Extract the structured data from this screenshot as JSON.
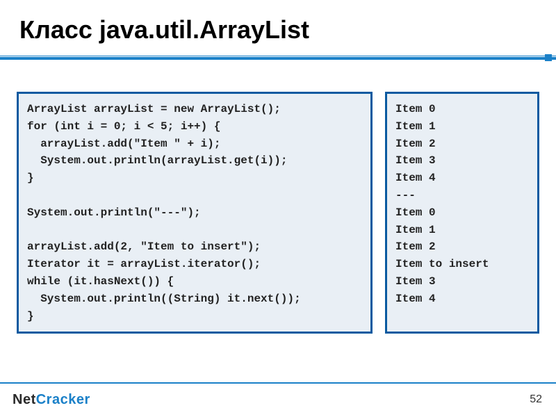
{
  "title": "Класс java.util.ArrayList",
  "code_lines": [
    "ArrayList arrayList = new ArrayList();",
    "for (int i = 0; i < 5; i++) {",
    "  arrayList.add(\"Item \" + i);",
    "  System.out.println(arrayList.get(i));",
    "}",
    "",
    "System.out.println(\"---\");",
    "",
    "arrayList.add(2, \"Item to insert\");",
    "Iterator it = arrayList.iterator();",
    "while (it.hasNext()) {",
    "  System.out.println((String) it.next());",
    "}"
  ],
  "output_lines": [
    "Item 0",
    "Item 1",
    "Item 2",
    "Item 3",
    "Item 4",
    "---",
    "Item 0",
    "Item 1",
    "Item 2",
    "Item to insert",
    "Item 3",
    "Item 4"
  ],
  "footer": {
    "brand_part1": "Net",
    "brand_part2": "Cracker",
    "page_number": "52"
  },
  "colors": {
    "accent": "#1a80c8",
    "box_border": "#0a5aa0",
    "box_bg": "#e9eff5"
  }
}
